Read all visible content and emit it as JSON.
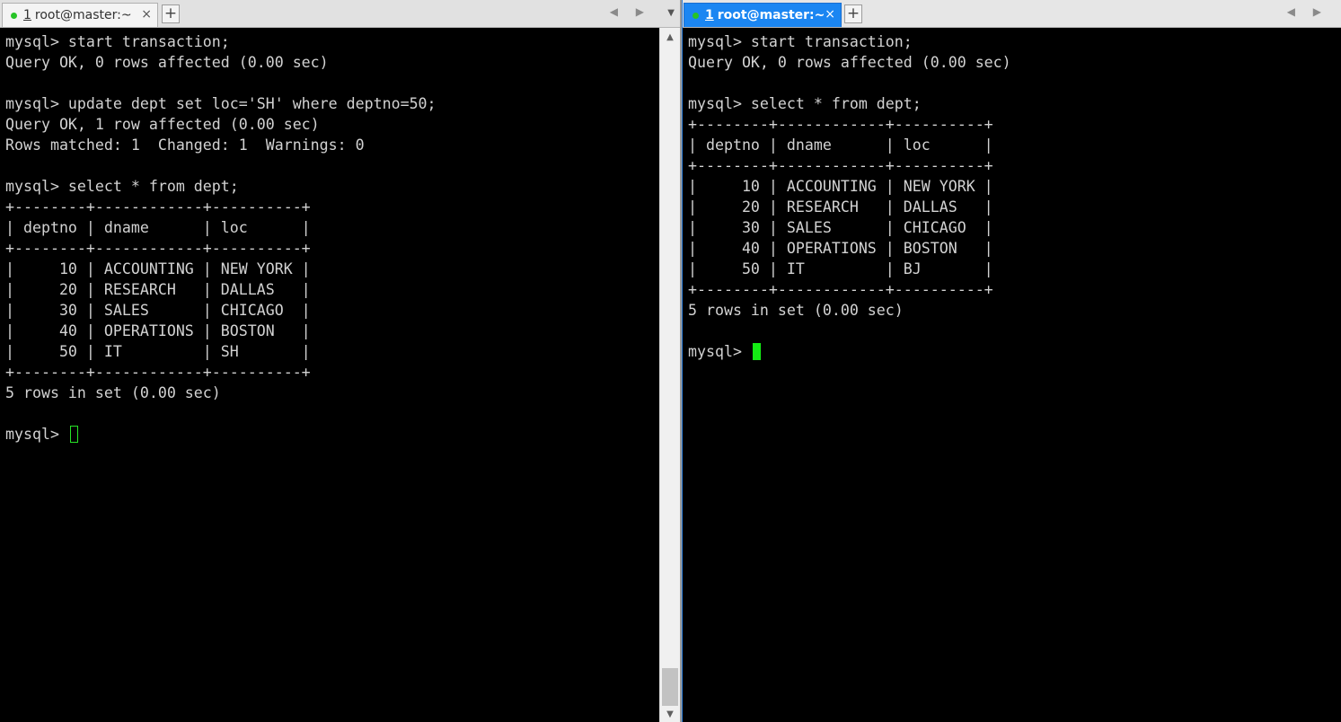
{
  "left_pane": {
    "tab": {
      "number": "1",
      "title": "root@master:~",
      "close": "×"
    },
    "add_tab": "+",
    "nav": "◀ ▶",
    "menu": "▼",
    "terminal_lines": [
      "mysql> start transaction;",
      "Query OK, 0 rows affected (0.00 sec)",
      "",
      "mysql> update dept set loc='SH' where deptno=50;",
      "Query OK, 1 row affected (0.00 sec)",
      "Rows matched: 1  Changed: 1  Warnings: 0",
      "",
      "mysql> select * from dept;",
      "+--------+------------+----------+",
      "| deptno | dname      | loc      |",
      "+--------+------------+----------+",
      "|     10 | ACCOUNTING | NEW YORK |",
      "|     20 | RESEARCH   | DALLAS   |",
      "|     30 | SALES      | CHICAGO  |",
      "|     40 | OPERATIONS | BOSTON   |",
      "|     50 | IT         | SH       |",
      "+--------+------------+----------+",
      "5 rows in set (0.00 sec)",
      ""
    ],
    "prompt": "mysql> ",
    "scroll_up": "▲",
    "scroll_down": "▼"
  },
  "right_pane": {
    "tab": {
      "number": "1",
      "title": "root@master:~",
      "close": "×"
    },
    "add_tab": "+",
    "nav": "◀ ▶",
    "terminal_lines": [
      "mysql> start transaction;",
      "Query OK, 0 rows affected (0.00 sec)",
      "",
      "mysql> select * from dept;",
      "+--------+------------+----------+",
      "| deptno | dname      | loc      |",
      "+--------+------------+----------+",
      "|     10 | ACCOUNTING | NEW YORK |",
      "|     20 | RESEARCH   | DALLAS   |",
      "|     30 | SALES      | CHICAGO  |",
      "|     40 | OPERATIONS | BOSTON   |",
      "|     50 | IT         | BJ       |",
      "+--------+------------+----------+",
      "5 rows in set (0.00 sec)",
      ""
    ],
    "prompt": "mysql> "
  },
  "colors": {
    "terminal_bg": "#000000",
    "terminal_fg": "#d2d2d2",
    "cursor": "#14ec14",
    "active_tab": "#1b86f2",
    "session_dot": "#27c427"
  }
}
